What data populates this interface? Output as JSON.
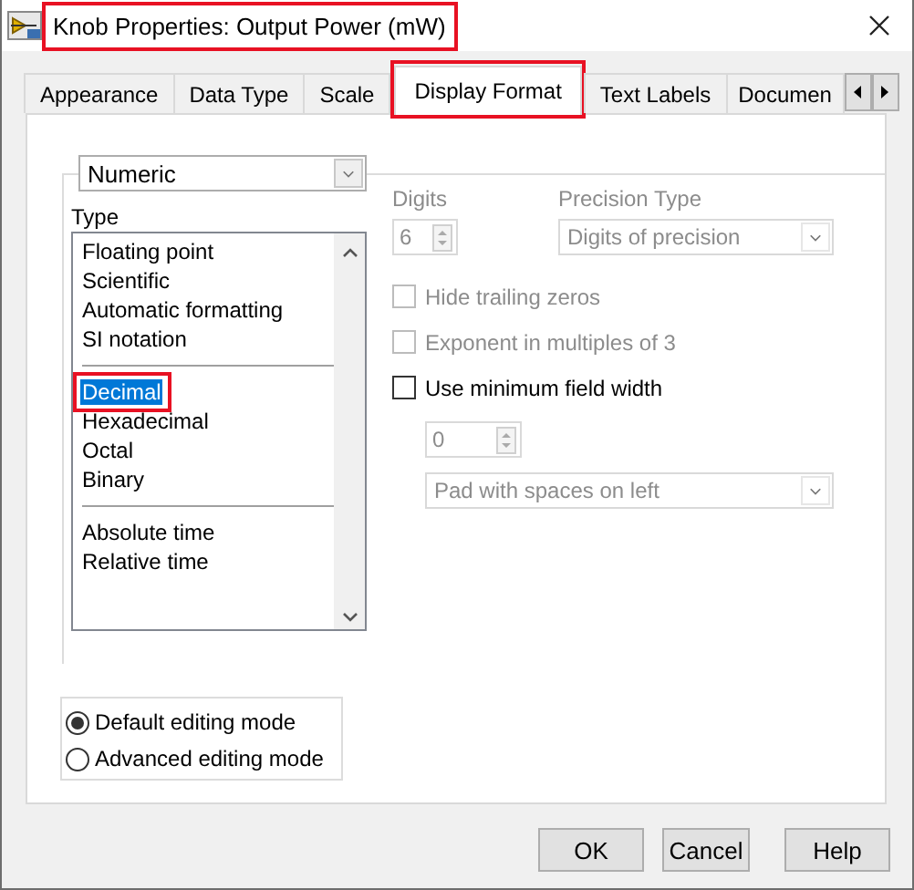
{
  "window": {
    "title": "Knob Properties: Output Power (mW)",
    "highlighted": true
  },
  "tabs": [
    {
      "label": "Appearance",
      "selected": false,
      "highlighted": false
    },
    {
      "label": "Data Type",
      "selected": false,
      "highlighted": false
    },
    {
      "label": "Scale",
      "selected": false,
      "highlighted": false
    },
    {
      "label": "Display Format",
      "selected": true,
      "highlighted": true
    },
    {
      "label": "Text Labels",
      "selected": false,
      "highlighted": false
    },
    {
      "label": "Documen",
      "selected": false,
      "highlighted": false
    }
  ],
  "format_category": {
    "value": "Numeric"
  },
  "type_list": {
    "label": "Type",
    "groups": [
      {
        "items": [
          {
            "label": "Floating point",
            "selected": false,
            "highlighted": false
          },
          {
            "label": "Scientific",
            "selected": false,
            "highlighted": false
          },
          {
            "label": "Automatic formatting",
            "selected": false,
            "highlighted": false
          },
          {
            "label": "SI notation",
            "selected": false,
            "highlighted": false
          }
        ]
      },
      {
        "items": [
          {
            "label": "Decimal",
            "selected": true,
            "highlighted": true
          },
          {
            "label": "Hexadecimal",
            "selected": false,
            "highlighted": false
          },
          {
            "label": "Octal",
            "selected": false,
            "highlighted": false
          },
          {
            "label": "Binary",
            "selected": false,
            "highlighted": false
          }
        ]
      },
      {
        "items": [
          {
            "label": "Absolute time",
            "selected": false,
            "highlighted": false
          },
          {
            "label": "Relative time",
            "selected": false,
            "highlighted": false
          }
        ]
      }
    ]
  },
  "digits": {
    "label": "Digits",
    "value": "6",
    "disabled": true
  },
  "precision_type": {
    "label": "Precision Type",
    "value": "Digits of precision",
    "disabled": true
  },
  "options": [
    {
      "label": "Hide trailing zeros",
      "checked": false,
      "disabled": true
    },
    {
      "label": "Exponent in multiples of 3",
      "checked": false,
      "disabled": true
    },
    {
      "label": "Use minimum field width",
      "checked": false,
      "disabled": false
    }
  ],
  "field_width": {
    "value": "0",
    "disabled": true
  },
  "padding": {
    "value": "Pad with spaces on left",
    "disabled": true
  },
  "editing_modes": [
    {
      "label": "Default editing mode",
      "selected": true
    },
    {
      "label": "Advanced editing mode",
      "selected": false
    }
  ],
  "buttons": [
    "OK",
    "Cancel",
    "Help"
  ]
}
